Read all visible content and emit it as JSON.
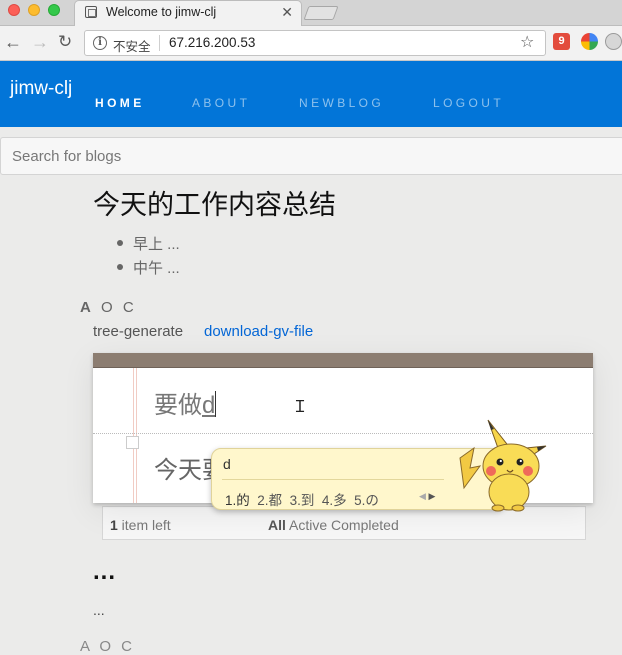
{
  "browser": {
    "tab_title": "Welcome to jimw-clj",
    "tab_close": "✕",
    "insecure_label": "不安全",
    "url": "67.216.200.53",
    "ext_badge": "9"
  },
  "site": {
    "brand": "jimw-clj",
    "menu": [
      {
        "label": "HOME",
        "active": true
      },
      {
        "label": "ABOUT",
        "active": false
      },
      {
        "label": "NEWBLOG",
        "active": false
      },
      {
        "label": "LOGOUT",
        "active": false
      }
    ],
    "search_placeholder": "Search for blogs"
  },
  "post": {
    "title": "今天的工作内容总结",
    "items": [
      "早上 ...",
      "中午 ..."
    ],
    "aoc_first": "A",
    "aoc_rest": "O C",
    "link_tree": "tree-generate",
    "link_gv": "download-gv-file"
  },
  "todo": {
    "input_text": "要做",
    "input_composing": "d",
    "item_text": "今天要",
    "count_number": "1",
    "count_suffix": " item left",
    "filters": [
      "All",
      "Active",
      "Completed"
    ]
  },
  "ime": {
    "composition": "d",
    "candidates": [
      "1.的",
      "2.都",
      "3.到",
      "4.多",
      "5.の"
    ],
    "prev_arrow": "◀",
    "next_arrow": "▶"
  },
  "post2": {
    "title": "...",
    "body": "...",
    "aoc": "A O C"
  }
}
